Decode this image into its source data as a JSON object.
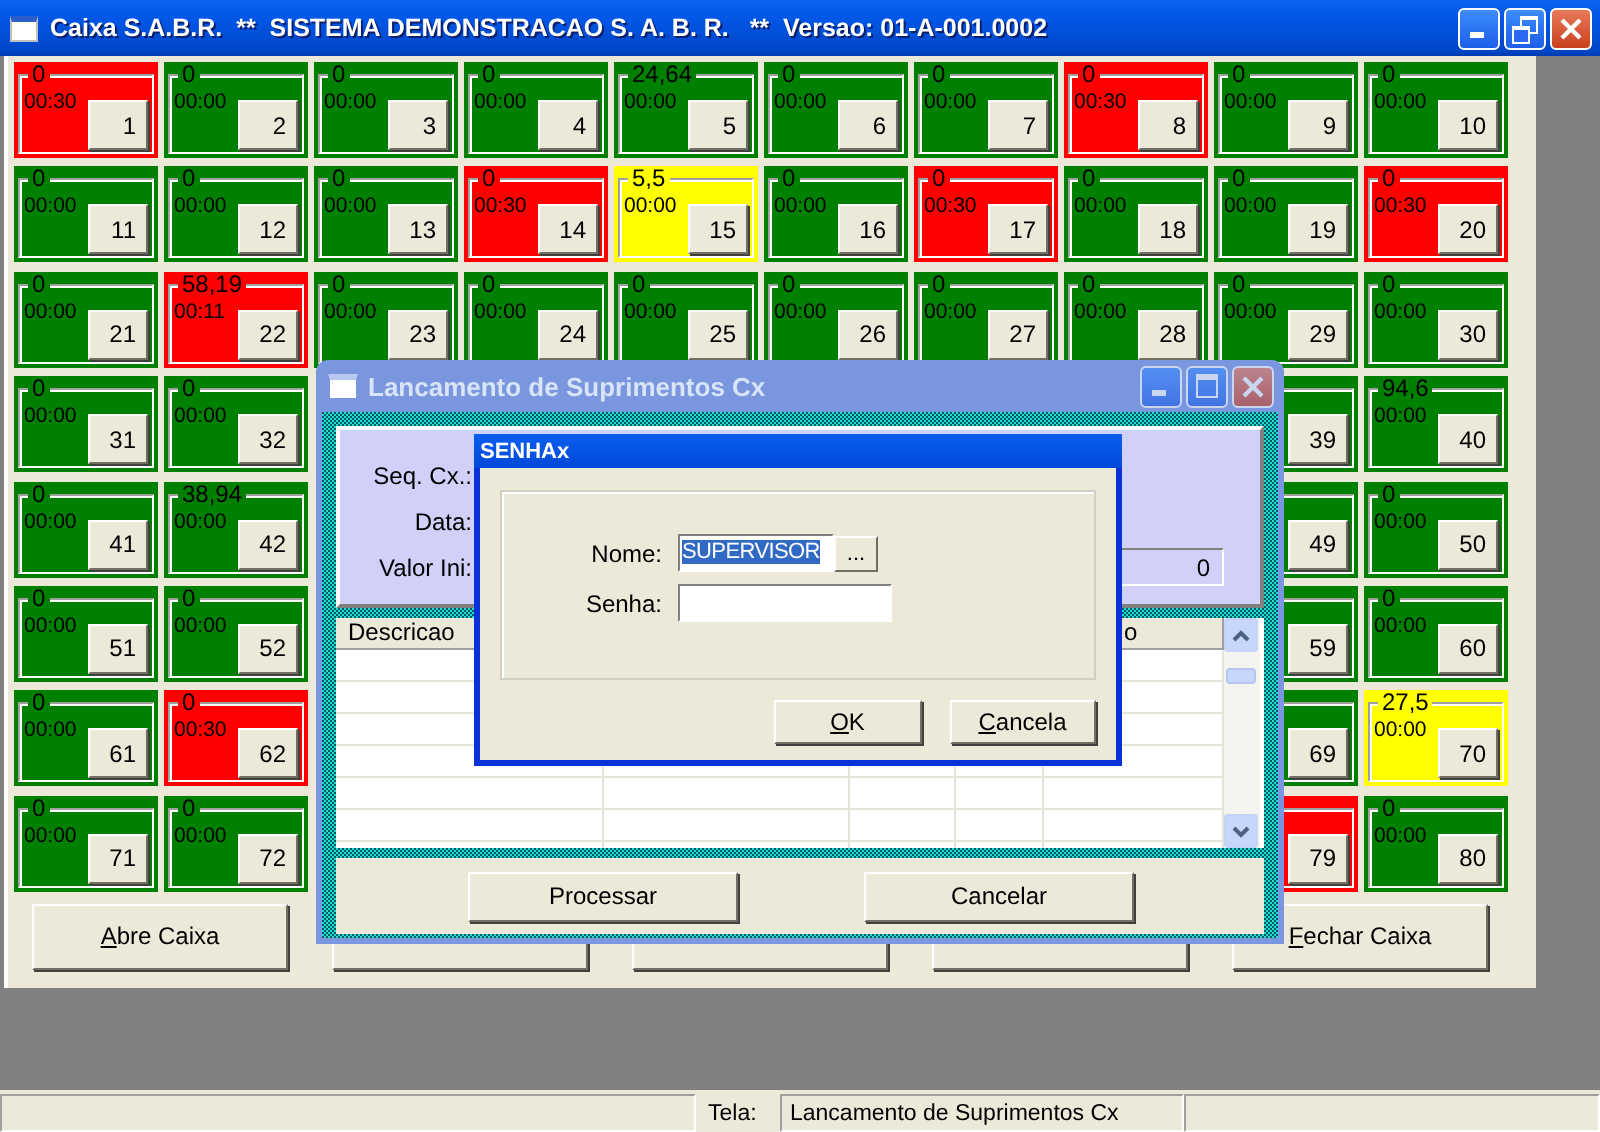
{
  "window": {
    "title": "Caixa S.A.B.R.  **  SISTEMA DEMONSTRACAO S. A. B. R.   **  Versao: 01-A-001.0002"
  },
  "table_rows": [
    {
      "tiles": [
        {
          "number": "1",
          "amount": "0",
          "time": "00:30",
          "color": "#ff0000"
        },
        {
          "number": "2",
          "amount": "0",
          "time": "00:00",
          "color": "#008000"
        },
        {
          "number": "3",
          "amount": "0",
          "time": "00:00",
          "color": "#008000"
        },
        {
          "number": "4",
          "amount": "0",
          "time": "00:00",
          "color": "#008000"
        },
        {
          "number": "5",
          "amount": "24,64",
          "time": "00:00",
          "color": "#008000"
        },
        {
          "number": "6",
          "amount": "0",
          "time": "00:00",
          "color": "#008000"
        },
        {
          "number": "7",
          "amount": "0",
          "time": "00:00",
          "color": "#008000"
        },
        {
          "number": "8",
          "amount": "0",
          "time": "00:30",
          "color": "#ff0000"
        },
        {
          "number": "9",
          "amount": "0",
          "time": "00:00",
          "color": "#008000"
        },
        {
          "number": "10",
          "amount": "0",
          "time": "00:00",
          "color": "#008000"
        }
      ]
    },
    {
      "tiles": [
        {
          "number": "11",
          "amount": "0",
          "time": "00:00",
          "color": "#008000"
        },
        {
          "number": "12",
          "amount": "0",
          "time": "00:00",
          "color": "#008000"
        },
        {
          "number": "13",
          "amount": "0",
          "time": "00:00",
          "color": "#008000"
        },
        {
          "number": "14",
          "amount": "0",
          "time": "00:30",
          "color": "#ff0000"
        },
        {
          "number": "15",
          "amount": "5,5",
          "time": "00:00",
          "color": "#ffff00"
        },
        {
          "number": "16",
          "amount": "0",
          "time": "00:00",
          "color": "#008000"
        },
        {
          "number": "17",
          "amount": "0",
          "time": "00:30",
          "color": "#ff0000"
        },
        {
          "number": "18",
          "amount": "0",
          "time": "00:00",
          "color": "#008000"
        },
        {
          "number": "19",
          "amount": "0",
          "time": "00:00",
          "color": "#008000"
        },
        {
          "number": "20",
          "amount": "0",
          "time": "00:30",
          "color": "#ff0000"
        }
      ]
    },
    {
      "tiles": [
        {
          "number": "21",
          "amount": "0",
          "time": "00:00",
          "color": "#008000"
        },
        {
          "number": "22",
          "amount": "58,19",
          "time": "00:11",
          "color": "#ff0000"
        },
        {
          "number": "23",
          "amount": "0",
          "time": "00:00",
          "color": "#008000"
        },
        {
          "number": "24",
          "amount": "0",
          "time": "00:00",
          "color": "#008000"
        },
        {
          "number": "25",
          "amount": "0",
          "time": "00:00",
          "color": "#008000"
        },
        {
          "number": "26",
          "amount": "0",
          "time": "00:00",
          "color": "#008000"
        },
        {
          "number": "27",
          "amount": "0",
          "time": "00:00",
          "color": "#008000"
        },
        {
          "number": "28",
          "amount": "0",
          "time": "00:00",
          "color": "#008000"
        },
        {
          "number": "29",
          "amount": "0",
          "time": "00:00",
          "color": "#008000"
        },
        {
          "number": "30",
          "amount": "0",
          "time": "00:00",
          "color": "#008000"
        }
      ]
    },
    {
      "tiles": [
        {
          "number": "31",
          "amount": "0",
          "time": "00:00",
          "color": "#008000"
        },
        {
          "number": "32",
          "amount": "0",
          "time": "00:00",
          "color": "#008000"
        }
      ],
      "right_tiles": [
        {
          "number": "39",
          "color": "#008000"
        },
        {
          "number": "40",
          "amount": "94,6",
          "time": "00:00",
          "color": "#008000"
        }
      ]
    },
    {
      "tiles": [
        {
          "number": "41",
          "amount": "0",
          "time": "00:00",
          "color": "#008000"
        },
        {
          "number": "42",
          "amount": "38,94",
          "time": "00:00",
          "color": "#008000"
        }
      ],
      "right_tiles": [
        {
          "number": "49",
          "color": "#008000"
        },
        {
          "number": "50",
          "amount": "0",
          "time": "00:00",
          "color": "#008000"
        }
      ]
    },
    {
      "tiles": [
        {
          "number": "51",
          "amount": "0",
          "time": "00:00",
          "color": "#008000"
        },
        {
          "number": "52",
          "amount": "0",
          "time": "00:00",
          "color": "#008000"
        }
      ],
      "right_tiles": [
        {
          "number": "59",
          "color": "#008000"
        },
        {
          "number": "60",
          "amount": "0",
          "time": "00:00",
          "color": "#008000"
        }
      ]
    },
    {
      "tiles": [
        {
          "number": "61",
          "amount": "0",
          "time": "00:00",
          "color": "#008000"
        },
        {
          "number": "62",
          "amount": "0",
          "time": "00:30",
          "color": "#ff0000"
        }
      ],
      "right_tiles": [
        {
          "number": "69",
          "color": "#008000"
        },
        {
          "number": "70",
          "amount": "27,5",
          "time": "00:00",
          "color": "#ffff00"
        }
      ]
    },
    {
      "tiles": [
        {
          "number": "71",
          "amount": "0",
          "time": "00:00",
          "color": "#008000"
        },
        {
          "number": "72",
          "amount": "0",
          "time": "00:00",
          "color": "#008000"
        }
      ],
      "right_tiles": [
        {
          "number": "79",
          "color": "#ff0000"
        },
        {
          "number": "80",
          "amount": "0",
          "time": "00:00",
          "color": "#008000"
        }
      ]
    }
  ],
  "actions": [
    {
      "kind": "button",
      "label": "Abre Caixa"
    },
    {
      "kind": "covered"
    },
    {
      "kind": "covered"
    },
    {
      "kind": "covered"
    },
    {
      "kind": "button",
      "label": "Fechar Caixa"
    }
  ],
  "supply_dialog": {
    "title": "Lancamento de Suprimentos Cx",
    "fields": [
      {
        "label": "Seq. Cx.:"
      },
      {
        "label": "Data:"
      },
      {
        "label": "Valor Ini:",
        "value": "0"
      }
    ],
    "columns": [
      {
        "label": "Descricao"
      },
      {
        "label": "o"
      }
    ],
    "buttons": [
      "Processar",
      "Cancelar"
    ]
  },
  "password_dialog": {
    "title": "SENHAx",
    "fields": [
      {
        "label": "Nome:",
        "value": "SUPERVISOR",
        "selected": true,
        "kind": "lookup"
      },
      {
        "label": "Senha:",
        "kind": "text"
      }
    ],
    "lookup_button": "...",
    "buttons": [
      "OK",
      "Cancela"
    ]
  },
  "status_bar": {
    "label": "Tela:",
    "value": "Lancamento de Suprimentos Cx"
  }
}
